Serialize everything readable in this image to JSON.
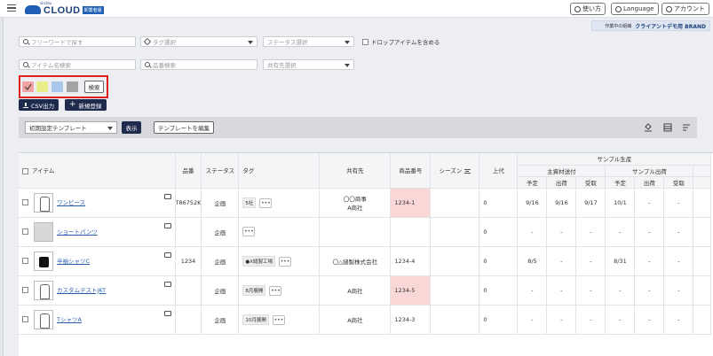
{
  "header": {
    "logo_text": "CLOUD",
    "logo_small": "sircleu",
    "logo_badge": "卸業者版",
    "help_label": "使い方",
    "language_label": "Language",
    "account_label": "アカウント"
  },
  "brand": {
    "prefix": "作業中の組織",
    "name": "クライアントデモ用 BRAND"
  },
  "filters": {
    "freeword_placeholder": "フリーワードで探す",
    "tag_placeholder": "タグ選択",
    "status_placeholder": "ステータス選択",
    "include_drop_label": "ドロップアイテムを含める",
    "item_name_placeholder": "アイテム名検索",
    "product_no_placeholder": "品番検索",
    "supplier_placeholder": "共有先選択",
    "search_label": "検索",
    "colors": [
      "#f3a3a3",
      "#e9ee8a",
      "#a9c7e8",
      "#a3a3a3"
    ]
  },
  "actions": {
    "csv_label": "CSV出力",
    "new_label": "新規登録"
  },
  "toolbar": {
    "template_value": "初期設定テンプレート",
    "show_label": "表示",
    "edit_template_label": "テンプレートを編集"
  },
  "table": {
    "h_item": "アイテム",
    "h_hinban": "品番",
    "h_status": "ステータス",
    "h_tag": "タグ",
    "h_share": "共有先",
    "h_product_no": "商品番号",
    "h_season": "シーズン",
    "h_upper": "上代",
    "h_sample": "サンプル生産",
    "h_main_send": "主資材送付",
    "h_sample_out": "サンプル出荷",
    "h_plan": "予定",
    "h_ship": "出荷",
    "h_recv": "受取",
    "rows": [
      {
        "name": "ワンピース",
        "hinban": "T86752K",
        "status": "企画",
        "tag": "5社",
        "share1": "〇〇商事",
        "share2": "A商社",
        "product_no": "1234-1",
        "pink": true,
        "upper": "0",
        "m_plan": "9/16",
        "m_ship": "9/16",
        "m_recv": "9/17",
        "s_plan": "10/1",
        "s_ship": "-",
        "s_recv": "-",
        "thumb": "line"
      },
      {
        "name": "ショートパンツ",
        "hinban": "",
        "status": "企画",
        "tag": "",
        "share1": "",
        "share2": "",
        "product_no": "",
        "pink": false,
        "upper": "0",
        "m_plan": "-",
        "m_ship": "-",
        "m_recv": "-",
        "s_plan": "-",
        "s_ship": "-",
        "s_recv": "-",
        "thumb": "gray"
      },
      {
        "name": "半袖シャツC",
        "hinban": "1234",
        "status": "企画",
        "tag": "●X縫製工場",
        "share1": "〇△縫製株式会社",
        "share2": "",
        "product_no": "1234-4",
        "pink": false,
        "upper": "0",
        "m_plan": "8/5",
        "m_ship": "-",
        "m_recv": "-",
        "s_plan": "8/31",
        "s_ship": "-",
        "s_recv": "-",
        "thumb": "black"
      },
      {
        "name": "カスタムテストJKT",
        "hinban": "",
        "status": "企画",
        "tag": "8月展開",
        "share1": "A商社",
        "share2": "",
        "product_no": "1234-5",
        "pink": true,
        "upper": "0",
        "m_plan": "-",
        "m_ship": "-",
        "m_recv": "-",
        "s_plan": "-",
        "s_ship": "-",
        "s_recv": "-",
        "thumb": "line"
      },
      {
        "name": "TシャツA",
        "hinban": "",
        "status": "企画",
        "tag": "10月展開",
        "share1": "A商社",
        "share2": "",
        "product_no": "1234-3",
        "pink": false,
        "upper": "0",
        "m_plan": "-",
        "m_ship": "-",
        "m_recv": "-",
        "s_plan": "-",
        "s_ship": "-",
        "s_recv": "-",
        "thumb": "line"
      }
    ]
  }
}
